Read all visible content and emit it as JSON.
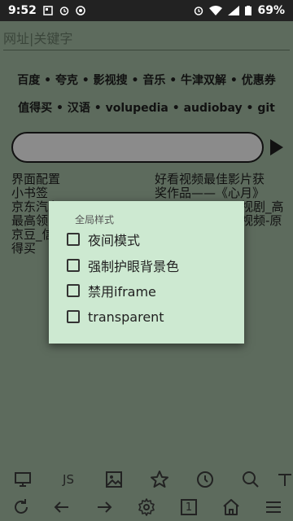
{
  "status_bar": {
    "time": "9:52",
    "battery": "69%"
  },
  "url_bar": {
    "placeholder": "网址|关键字"
  },
  "quick_links": {
    "row1": [
      "百度",
      "夸克",
      "影视搜",
      "音乐",
      "牛津双解",
      "优惠券"
    ],
    "row2": [
      "值得买",
      "汉语",
      "volupedia",
      "audiobay",
      "git"
    ],
    "separator": " • "
  },
  "bookmarks": {
    "left": [
      "界面配置",
      "小书签",
      "京东汽车",
      "最高领",
      "京豆_信",
      "得买"
    ],
    "right": [
      "好看视频最佳影片获",
      "奖作品——《心月》",
      "",
      "视剧_高",
      "视频-原"
    ]
  },
  "dialog": {
    "title": "全局样式",
    "options": [
      {
        "label": "夜间模式",
        "checked": false
      },
      {
        "label": "强制护眼背景色",
        "checked": false
      },
      {
        "label": "禁用iframe",
        "checked": false
      },
      {
        "label": "transparent",
        "checked": false
      }
    ]
  },
  "toolbar_top": {
    "js_label": "JS",
    "icons": [
      "desktop-icon",
      "js-icon",
      "image-icon",
      "star-icon",
      "history-icon",
      "search-icon",
      "text-size-icon"
    ]
  },
  "toolbar_bottom": {
    "tab_count": "1",
    "icons": [
      "refresh-icon",
      "back-icon",
      "forward-icon",
      "settings-icon",
      "tabs-icon",
      "home-icon",
      "menu-icon"
    ]
  },
  "colors": {
    "background": "#5d6b5d",
    "dialog_bg": "#cde9d1",
    "status_bar": "#222222"
  }
}
